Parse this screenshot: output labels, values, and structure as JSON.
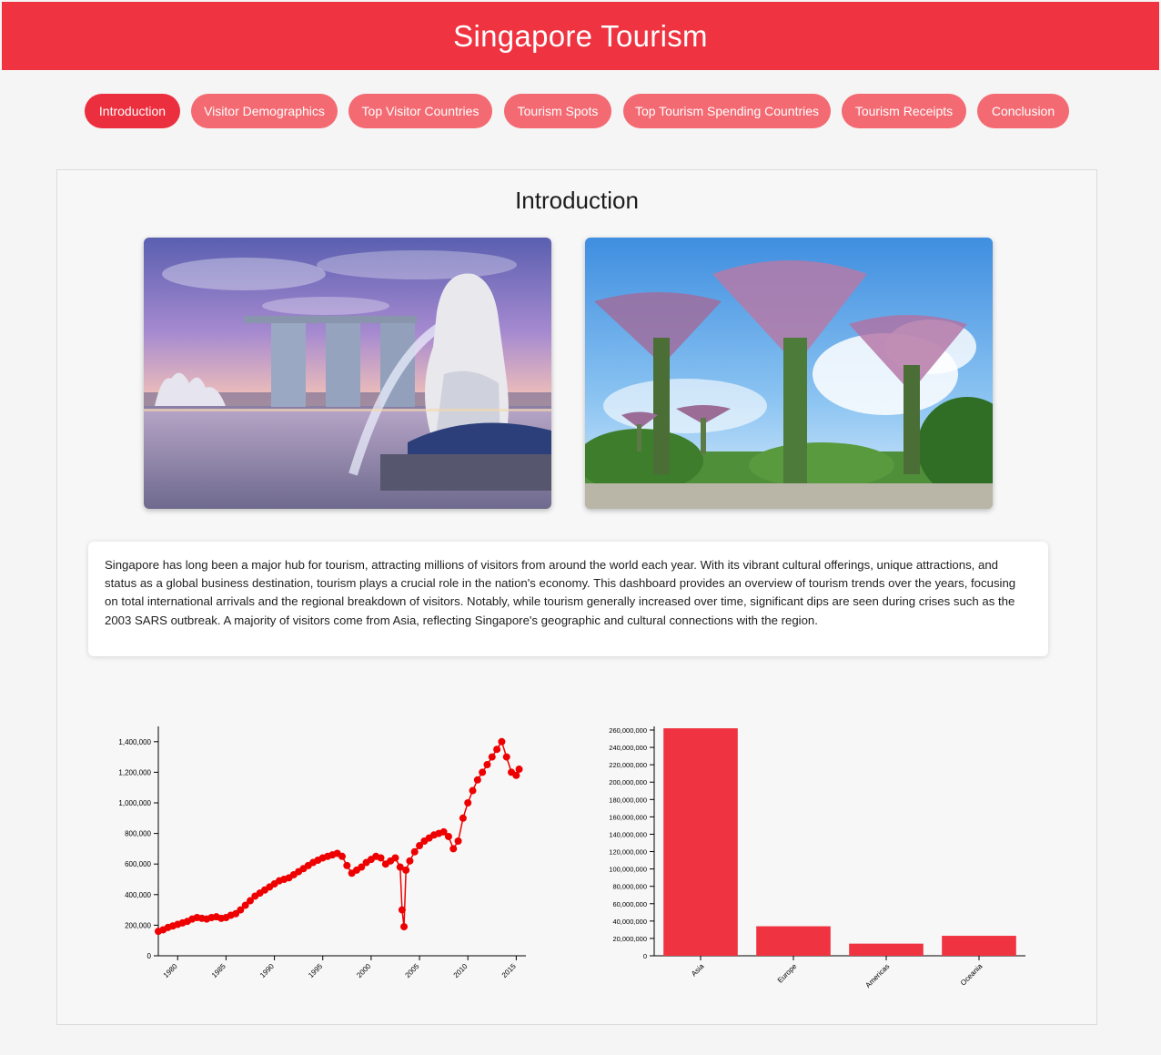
{
  "header": {
    "title": "Singapore Tourism"
  },
  "nav": {
    "items": [
      {
        "label": "Introduction",
        "active": true
      },
      {
        "label": "Visitor Demographics",
        "active": false
      },
      {
        "label": "Top Visitor Countries",
        "active": false
      },
      {
        "label": "Tourism Spots",
        "active": false
      },
      {
        "label": "Top Tourism Spending Countries",
        "active": false
      },
      {
        "label": "Tourism Receipts",
        "active": false
      },
      {
        "label": "Conclusion",
        "active": false
      }
    ]
  },
  "main": {
    "section_title": "Introduction",
    "images": [
      {
        "icon": "marina-bay-sands-merlion-photo"
      },
      {
        "icon": "gardens-by-the-bay-supertrees-photo"
      }
    ],
    "intro_text": "Singapore has long been a major hub for tourism, attracting millions of visitors from around the world each year. With its vibrant cultural offerings, unique attractions, and status as a global business destination, tourism plays a crucial role in the nation's economy. This dashboard provides an overview of tourism trends over the years, focusing on total international arrivals and the regional breakdown of visitors. Notably, while tourism generally increased over time, significant dips are seen during crises such as the 2003 SARS outbreak. A majority of visitors come from Asia, reflecting Singapore's geographic and cultural connections with the region."
  },
  "colors": {
    "accent": "#ef3340",
    "nav_inactive": "#f36a72",
    "series": "#ee0000",
    "bar": "#ef3340"
  },
  "chart_data": [
    {
      "type": "line",
      "xlim": [
        1978,
        2016
      ],
      "ylim": [
        0,
        1500000
      ],
      "xticks": [
        1980,
        1985,
        1990,
        1995,
        2000,
        2005,
        2010,
        2015
      ],
      "xtick_labels": [
        "1980",
        "1985",
        "1990",
        "1995",
        "2000",
        "2005",
        "2010",
        "2015"
      ],
      "yticks": [
        0,
        200000,
        400000,
        600000,
        800000,
        1000000,
        1200000,
        1400000
      ],
      "ytick_labels": [
        "0",
        "200,000",
        "400,000",
        "600,000",
        "800,000",
        "1,000,000",
        "1,200,000",
        "1,400,000"
      ],
      "markers": true,
      "series": [
        {
          "x": [
            1978.0,
            1978.5,
            1979.0,
            1979.5,
            1980.0,
            1980.5,
            1981.0,
            1981.5,
            1982.0,
            1982.5,
            1983.0,
            1983.5,
            1984.0,
            1984.5,
            1985.0,
            1985.5,
            1986.0,
            1986.5,
            1987.0,
            1987.5,
            1988.0,
            1988.5,
            1989.0,
            1989.5,
            1990.0,
            1990.5,
            1991.0,
            1991.5,
            1992.0,
            1992.5,
            1993.0,
            1993.5,
            1994.0,
            1994.5,
            1995.0,
            1995.5,
            1996.0,
            1996.5,
            1997.0,
            1997.5,
            1998.0,
            1998.5,
            1999.0,
            1999.5,
            2000.0,
            2000.5,
            2001.0,
            2001.5,
            2002.0,
            2002.5,
            2003.0,
            2003.2,
            2003.4,
            2003.6,
            2004.0,
            2004.5,
            2005.0,
            2005.5,
            2006.0,
            2006.5,
            2007.0,
            2007.5,
            2008.0,
            2008.5,
            2009.0,
            2009.5,
            2010.0,
            2010.5,
            2011.0,
            2011.5,
            2012.0,
            2012.5,
            2013.0,
            2013.5,
            2014.0,
            2014.5,
            2015.0,
            2015.3
          ],
          "y": [
            160000,
            170000,
            185000,
            195000,
            205000,
            215000,
            225000,
            240000,
            250000,
            245000,
            240000,
            250000,
            255000,
            245000,
            250000,
            265000,
            275000,
            300000,
            330000,
            360000,
            390000,
            410000,
            430000,
            450000,
            470000,
            490000,
            500000,
            510000,
            530000,
            550000,
            570000,
            590000,
            610000,
            625000,
            640000,
            650000,
            660000,
            670000,
            650000,
            590000,
            540000,
            560000,
            580000,
            610000,
            630000,
            650000,
            640000,
            600000,
            620000,
            640000,
            580000,
            300000,
            190000,
            560000,
            620000,
            680000,
            720000,
            750000,
            770000,
            790000,
            800000,
            810000,
            780000,
            700000,
            750000,
            900000,
            1000000,
            1080000,
            1150000,
            1200000,
            1250000,
            1300000,
            1350000,
            1400000,
            1300000,
            1200000,
            1180000,
            1220000
          ]
        }
      ]
    },
    {
      "type": "bar",
      "categories": [
        "Asia",
        "Europe",
        "Americas",
        "Oceania"
      ],
      "values": [
        262000000,
        34000000,
        14000000,
        23000000
      ],
      "ylim": [
        0,
        260000000
      ],
      "yticks": [
        0,
        20000000,
        40000000,
        60000000,
        80000000,
        100000000,
        120000000,
        140000000,
        160000000,
        180000000,
        200000000,
        220000000,
        240000000,
        260000000
      ],
      "ytick_labels": [
        "0",
        "20,000,000",
        "40,000,000",
        "60,000,000",
        "80,000,000",
        "100,000,000",
        "120,000,000",
        "140,000,000",
        "160,000,000",
        "180,000,000",
        "200,000,000",
        "220,000,000",
        "240,000,000",
        "260,000,000"
      ]
    }
  ]
}
